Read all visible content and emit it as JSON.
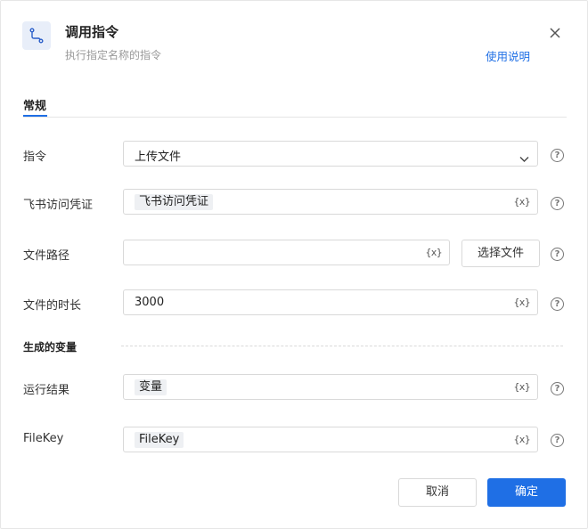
{
  "header": {
    "title": "调用指令",
    "subtitle": "执行指定名称的指令",
    "help_link": "使用说明",
    "icon": "route-icon",
    "close_icon": "close-icon"
  },
  "tabs": [
    {
      "label": "常规",
      "active": true
    }
  ],
  "form": {
    "command": {
      "label": "指令",
      "value": "上传文件"
    },
    "feishu_credential": {
      "label": "飞书访问凭证",
      "tag": "飞书访问凭证"
    },
    "file_path": {
      "label": "文件路径",
      "value": "",
      "button": "选择文件"
    },
    "file_duration": {
      "label": "文件的时长",
      "value": "3000"
    }
  },
  "output_section": {
    "title": "生成的变量",
    "run_result": {
      "label": "运行结果",
      "tag": "变量"
    },
    "file_key": {
      "label": "FileKey",
      "tag": "FileKey"
    }
  },
  "var_icon_text": "{x}",
  "help_icon_text": "?",
  "footer": {
    "cancel": "取消",
    "confirm": "确定"
  },
  "colors": {
    "accent": "#1f6fe5",
    "border": "#d9d9d9",
    "tag_bg": "#eef0f3"
  }
}
